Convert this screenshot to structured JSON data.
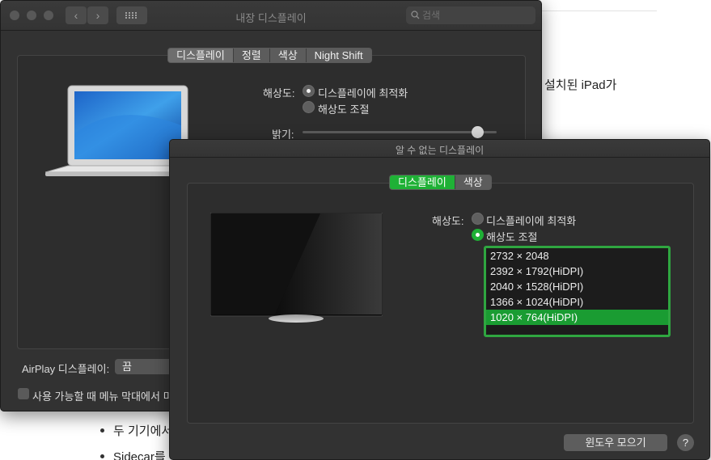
{
  "background_page": {
    "text_line": "설치된 iPad가",
    "bullets": [
      "두 기기에서",
      "Sidecar를"
    ]
  },
  "display_window": {
    "title": "내장 디스플레이",
    "search_placeholder": "검색",
    "back_glyph": "‹",
    "forward_glyph": "›",
    "tabs": [
      "디스플레이",
      "정렬",
      "색상",
      "Night Shift"
    ],
    "selected_tab": "디스플레이",
    "resolution_label": "해상도:",
    "resolution_options": [
      "디스플레이에 최적화",
      "해상도 조절"
    ],
    "selected_resolution_option": "디스플레이에 최적화",
    "brightness_label": "밝기:",
    "brightness_level": 0.93,
    "airplay_label": "AirPlay 디스플레이:",
    "airplay_value": "끔",
    "menu_checkbox_label": "사용 가능할 때 메뉴 막대에서 미러",
    "menu_checkbox_checked": false
  },
  "unknown_window": {
    "title": "알 수 없는 디스플레이",
    "tabs": [
      "디스플레이",
      "색상"
    ],
    "selected_tab": "디스플레이",
    "resolution_label": "해상도:",
    "resolution_options": [
      "디스플레이에 최적화",
      "해상도 조절"
    ],
    "selected_resolution_option": "해상도 조절",
    "resolutions": [
      "2732 × 2048",
      "2392 × 1792(HiDPI)",
      "2040 × 1528(HiDPI)",
      "1366 × 1024(HiDPI)",
      "1020 × 764(HiDPI)"
    ],
    "selected_resolution": "1020 × 764(HiDPI)",
    "gather_windows_button": "윈도우 모으기",
    "help_glyph": "?"
  },
  "colors": {
    "accent_green": "#1fb136",
    "window_bg": "#323232",
    "focus_ring": "#2fa640"
  }
}
